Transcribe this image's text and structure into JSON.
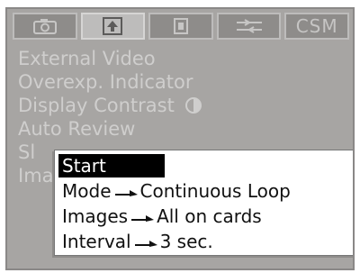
{
  "tabs": [
    {
      "icon": "camera-icon",
      "active": false
    },
    {
      "icon": "playback-icon",
      "active": true
    },
    {
      "icon": "wrench-icon",
      "active": false
    },
    {
      "icon": "sliders-icon",
      "active": false
    },
    {
      "label": "CSM",
      "active": false
    }
  ],
  "menu": {
    "items": [
      "External Video",
      "Overexp. Indicator",
      "Display Contrast",
      "Auto Review",
      "Sl",
      "Ima"
    ]
  },
  "popup": {
    "title": "Start",
    "rows": [
      {
        "label": "Mode",
        "value": "Continuous Loop"
      },
      {
        "label": "Images",
        "value": "All on cards"
      },
      {
        "label": "Interval",
        "value": "3 sec."
      }
    ]
  }
}
